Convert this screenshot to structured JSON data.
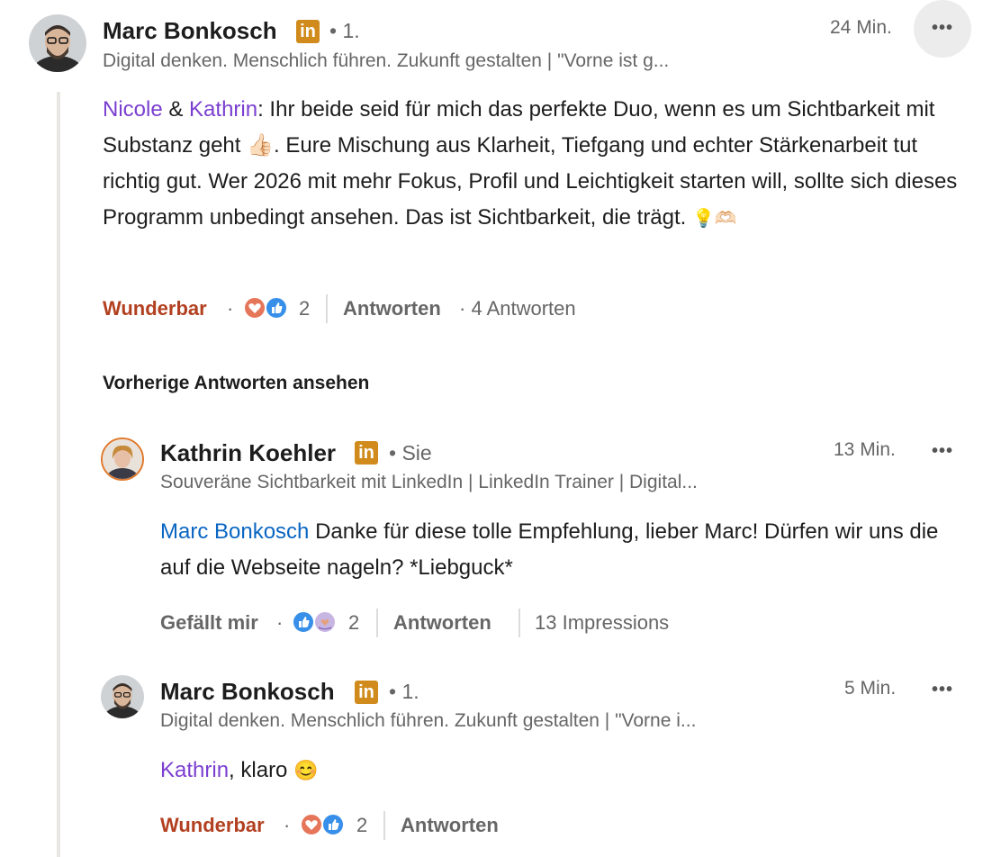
{
  "colors": {
    "mention_purple": "#7b3fd0",
    "mention_blue": "#0a66c2",
    "reaction_wunderbar": "#b24020",
    "linkedin_badge": "#d08b1c"
  },
  "comment_main": {
    "author": "Marc Bonkosch",
    "badge": "in",
    "degree": "• 1.",
    "headline": "Digital denken. Menschlich führen. Zukunft gestalten | \"Vorne ist g...",
    "time": "24 Min.",
    "more": "•••",
    "mention1": "Nicole",
    "amp": " & ",
    "mention2": "Kathrin",
    "text_a": ": Ihr beide seid für mich das perfekte Duo, wenn es um Sichtbarkeit mit Substanz geht ",
    "emoji_a": "👍🏻",
    "text_b": ". Eure Mischung aus Klarheit, Tiefgang und echter Stärkenarbeit tut richtig gut. Wer 2026 mit mehr Fokus, Profil und Leichtigkeit starten will, sollte sich dieses Programm unbedingt ansehen. Das ist Sichtbarkeit, die trägt. ",
    "emoji_b": "💡🫶🏻",
    "reaction_label": "Wunderbar",
    "dot": "·",
    "reaction_count": "2",
    "reply_label": "Antworten",
    "replies_count": "· 4 Antworten",
    "reaction_icons": [
      "heart-icon",
      "thumbs-up-icon"
    ]
  },
  "prev_replies_label": "Vorherige Antworten ansehen",
  "reply1": {
    "author": "Kathrin Koehler",
    "badge": "in",
    "degree": "• Sie",
    "headline": "Souveräne Sichtbarkeit mit LinkedIn | LinkedIn Trainer | Digital...",
    "time": "13 Min.",
    "more": "•••",
    "mention": "Marc Bonkosch",
    "text": " Danke für diese tolle Empfehlung, lieber Marc! Dürfen wir uns die auf die Webseite nageln? *Liebguck*",
    "reaction_label": "Gefällt mir",
    "dot": "·",
    "reaction_count": "2",
    "reply_label": "Antworten",
    "impressions": "13 Impressions",
    "reaction_icons": [
      "thumbs-up-icon",
      "support-icon"
    ]
  },
  "reply2": {
    "author": "Marc Bonkosch",
    "badge": "in",
    "degree": "• 1.",
    "headline": "Digital denken. Menschlich führen. Zukunft gestalten | \"Vorne i...",
    "time": "5 Min.",
    "more": "•••",
    "mention": "Kathrin",
    "text": ", klaro ",
    "emoji": "😊",
    "reaction_label": "Wunderbar",
    "dot": "·",
    "reaction_count": "2",
    "reply_label": "Antworten",
    "reaction_icons": [
      "heart-icon",
      "thumbs-up-icon"
    ]
  }
}
